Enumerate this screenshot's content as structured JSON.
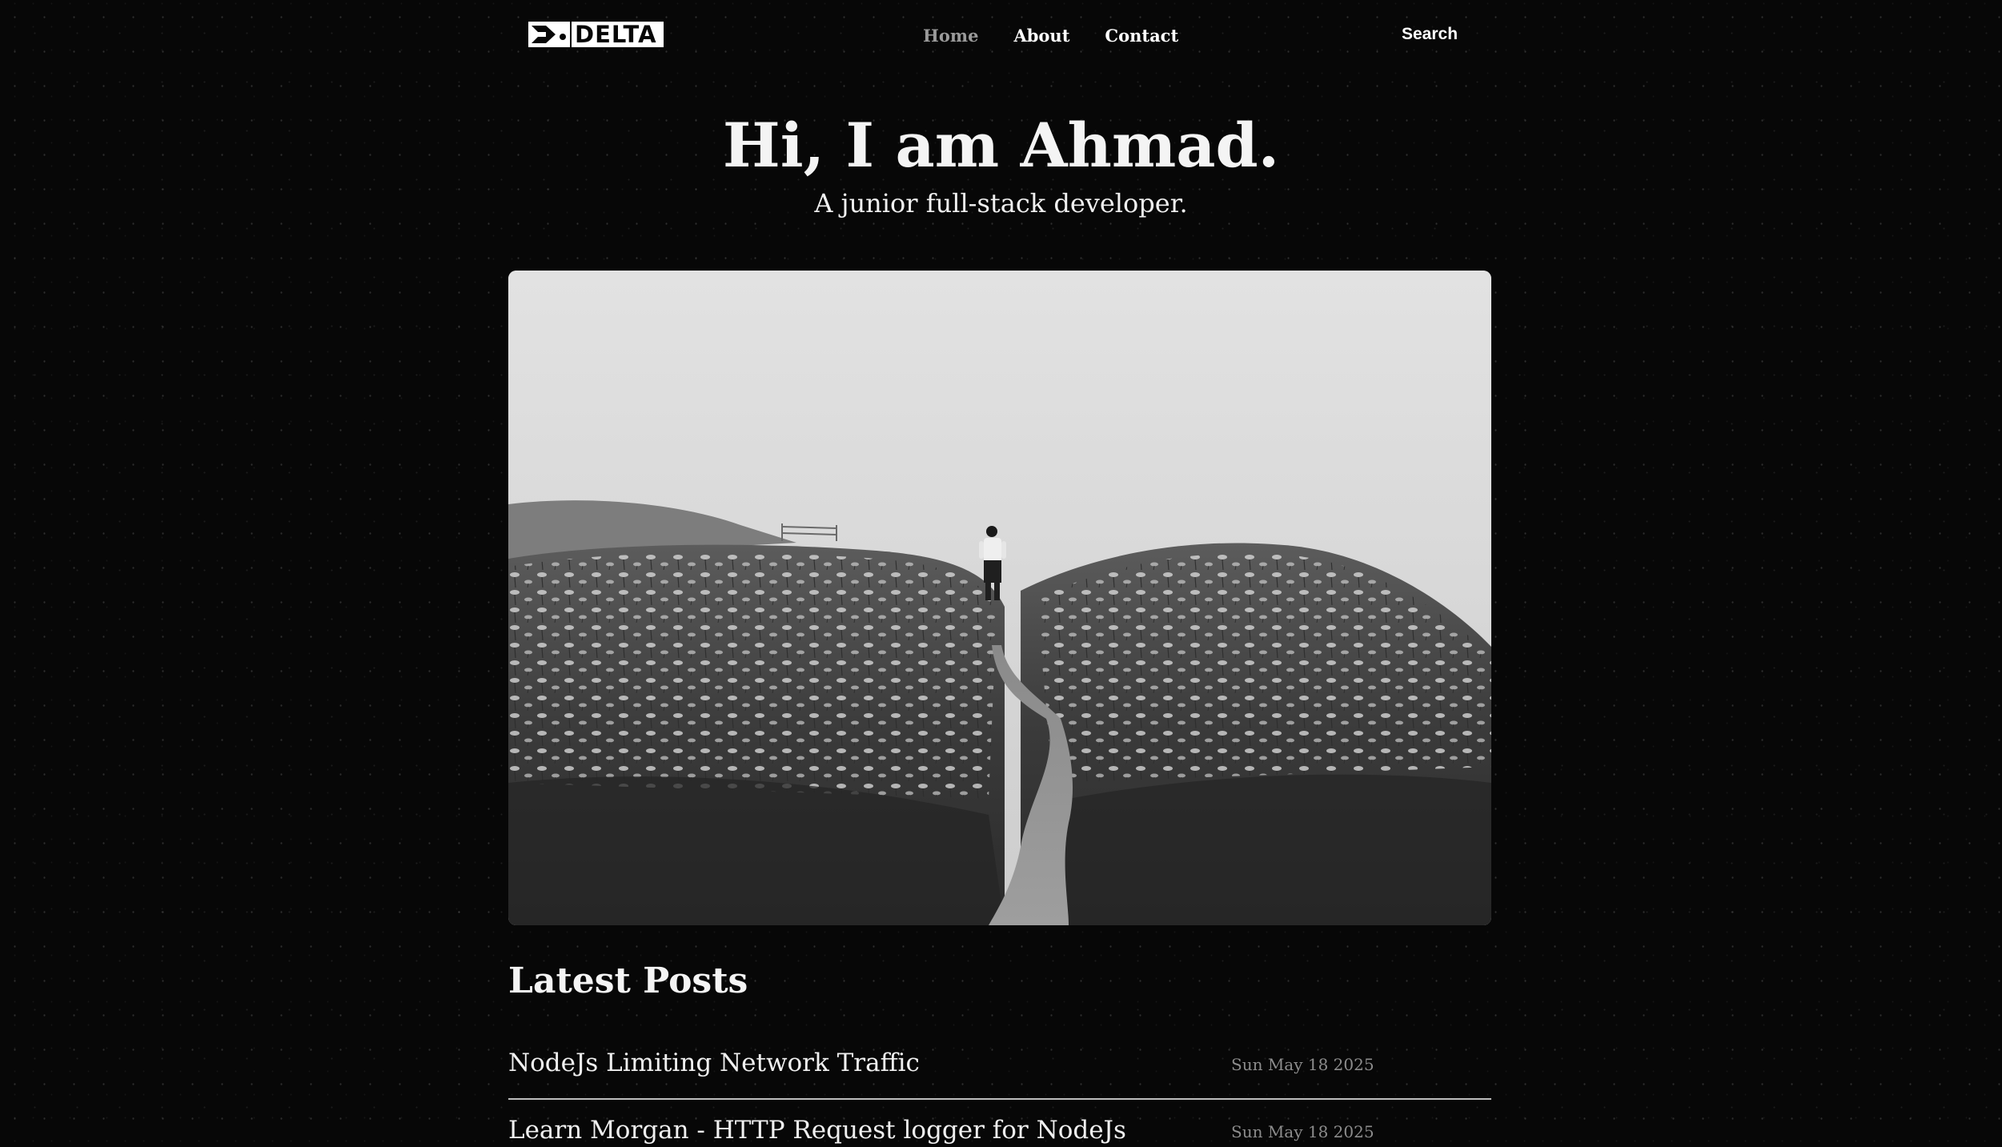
{
  "nav": {
    "logo_text": "DELTA",
    "links": [
      {
        "label": "Home",
        "active": true
      },
      {
        "label": "About",
        "active": false
      },
      {
        "label": "Contact",
        "active": false
      }
    ],
    "search_label": "Search"
  },
  "hero": {
    "title": "Hi, I am Ahmad.",
    "subtitle": "A junior full-stack developer."
  },
  "posts": {
    "heading": "Latest Posts",
    "items": [
      {
        "title": "NodeJs Limiting Network Traffic",
        "date": "Sun May 18 2025"
      },
      {
        "title": "Learn Morgan - HTTP Request logger for NodeJs",
        "date": "Sun May 18 2025"
      }
    ]
  },
  "colors": {
    "background": "#070707",
    "text": "#ffffff",
    "active_nav": "#9a9a9a",
    "date": "#8c8c8c",
    "divider": "#bdbdbd"
  }
}
